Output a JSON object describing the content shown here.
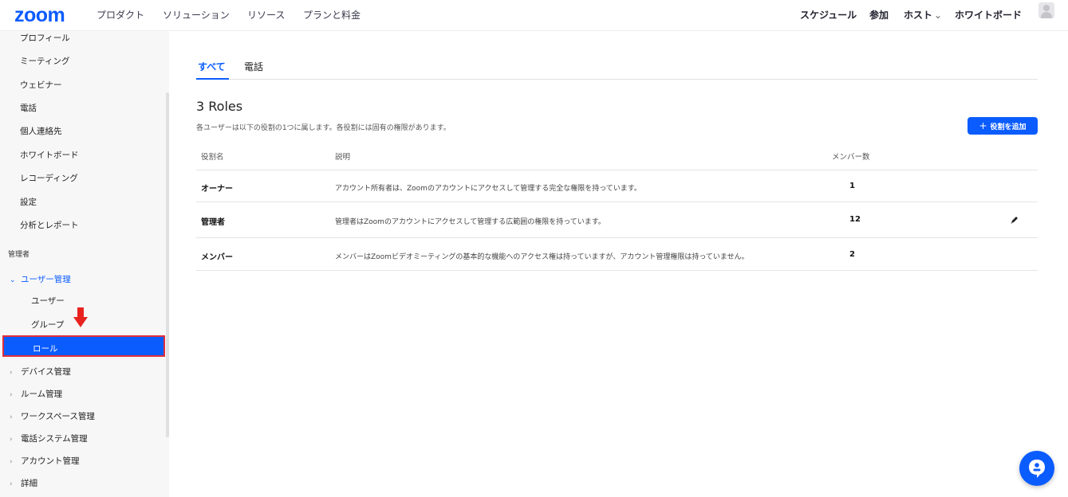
{
  "brand": {
    "logo": "zoom",
    "accent": "#0b5cff"
  },
  "topnav": {
    "left": [
      "プロダクト",
      "ソリューション",
      "リソース",
      "プランと料金"
    ],
    "right": [
      "スケジュール",
      "参加",
      "ホスト",
      "ホワイトボード"
    ],
    "host_chevron": "⌄"
  },
  "sidebar": {
    "items": [
      "プロフィール",
      "ミーティング",
      "ウェビナー",
      "電話",
      "個人連絡先",
      "ホワイトボード",
      "レコーディング",
      "設定",
      "分析とレポート"
    ],
    "admin_heading": "管理者",
    "user_mgmt": {
      "label": "ユーザー管理",
      "chevron": "⌄",
      "children": [
        "ユーザー",
        "グループ",
        "ロール"
      ]
    },
    "groups": [
      "デバイス管理",
      "ルーム管理",
      "ワークスペース管理",
      "電話システム管理",
      "アカウント管理",
      "詳細"
    ],
    "group_chevron": "›"
  },
  "tabs": [
    "すべて",
    "電話"
  ],
  "page": {
    "title": "3 Roles",
    "subtitle": "各ユーザーは以下の役割の1つに属します。各役割には固有の権限があります。",
    "add_button": "役割を追加",
    "add_icon": "+"
  },
  "table": {
    "headers": [
      "役割名",
      "説明",
      "メンバー数"
    ],
    "rows": [
      {
        "name": "オーナー",
        "desc": "アカウント所有者は、Zoomのアカウントにアクセスして管理する完全な権限を持っています。",
        "count": "1"
      },
      {
        "name": "管理者",
        "desc": "管理者はZoomのアカウントにアクセスして管理する広範囲の権限を持っています。",
        "count": "12"
      },
      {
        "name": "メンバー",
        "desc": "メンバーはZoomビデオミーティングの基本的な機能へのアクセス権は持っていますが、アカウント管理権限は持っていません。",
        "count": "2"
      }
    ]
  },
  "icons": {
    "edit": "pencil-icon",
    "chat": "chat-bot-icon",
    "annotation": "red-down-arrow"
  }
}
